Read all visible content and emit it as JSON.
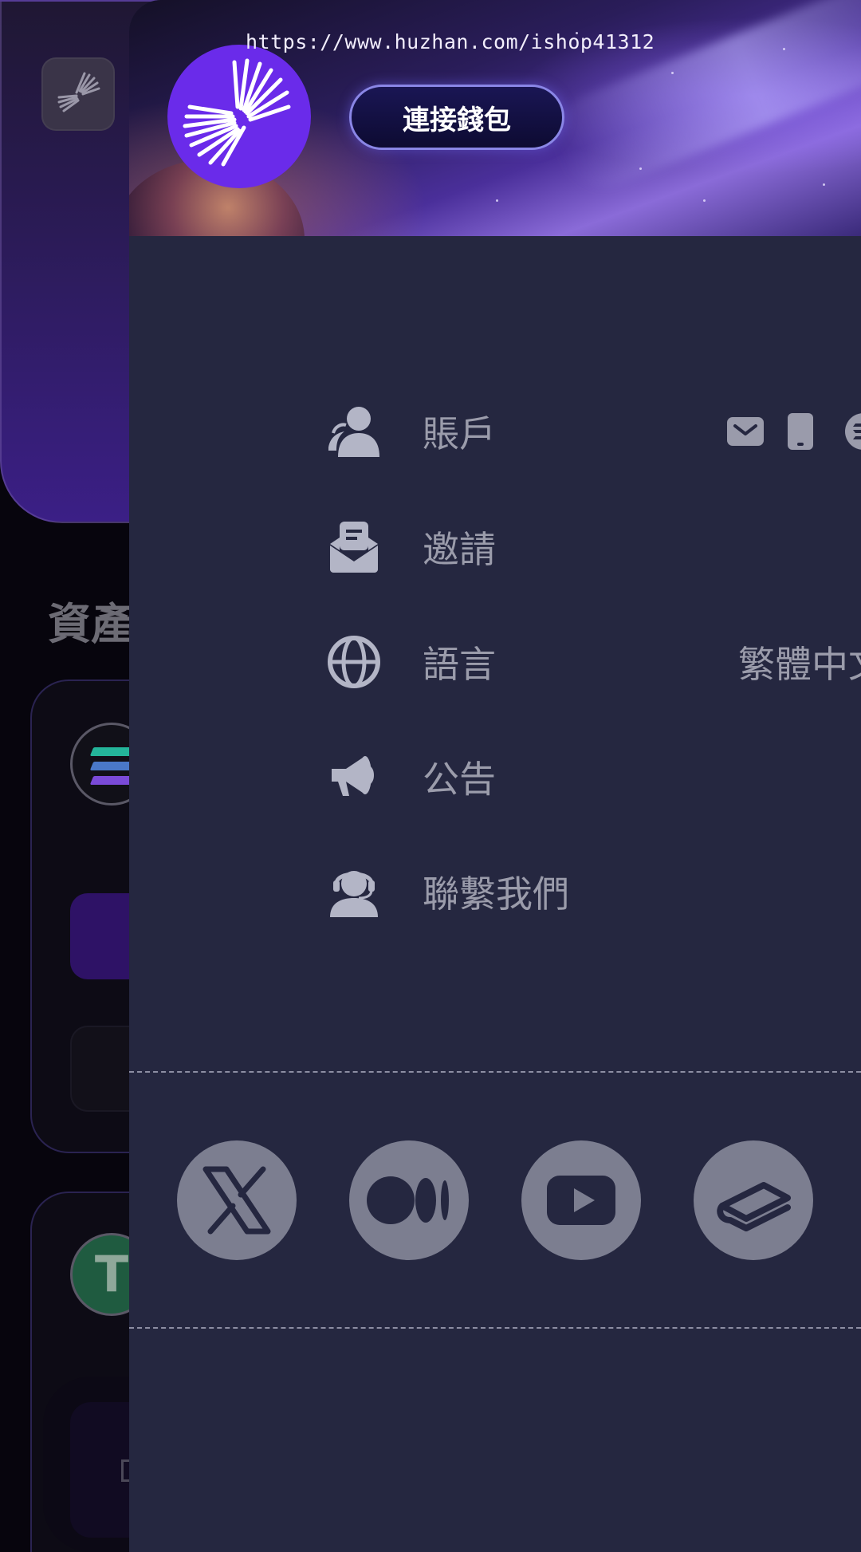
{
  "watermark": "https://www.huzhan.com/ishop41312",
  "header": {
    "connect_wallet_label": "連接錢包"
  },
  "background": {
    "section_title": "資產"
  },
  "menu": {
    "items": [
      {
        "label": "賬戶",
        "icon": "user-icon",
        "badges": [
          "mail-icon",
          "phone-icon",
          "solana-icon"
        ]
      },
      {
        "label": "邀請",
        "icon": "envelope-icon"
      },
      {
        "label": "語言",
        "icon": "globe-icon",
        "value": "繁體中文"
      },
      {
        "label": "公告",
        "icon": "megaphone-icon"
      },
      {
        "label": "聯繫我們",
        "icon": "headset-icon"
      }
    ]
  },
  "social_links": [
    "x-icon",
    "medium-icon",
    "youtube-icon",
    "gitbook-icon"
  ],
  "colors": {
    "drawer_bg": "#252740",
    "menu_text": "#9b9cab",
    "accent_purple": "#6a2bea",
    "social_circle": "#7c7e90"
  }
}
